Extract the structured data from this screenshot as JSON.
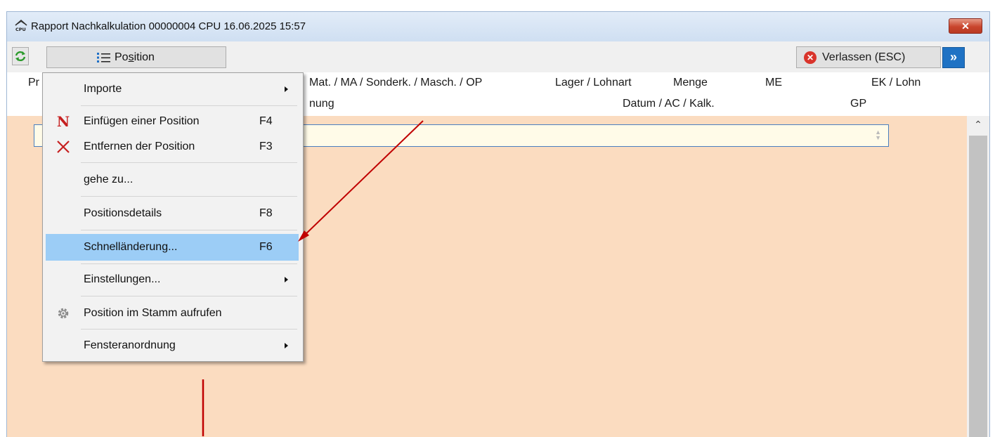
{
  "window": {
    "title": "Rapport Nachkalkulation 00000004 CPU 16.06.2025 15:57",
    "close_label": "✕"
  },
  "toolbar": {
    "position_label_pre": "Po",
    "position_label_u": "s",
    "position_label_post": "ition",
    "exit_label": "Verlassen (ESC)",
    "forward_label": "»"
  },
  "table_header": {
    "row1": [
      "Pr",
      "Mat. / MA / Sonderk. / Masch. / OP",
      "Lager / Lohnart",
      "Menge",
      "ME",
      "EK / Lohn"
    ],
    "row2": [
      "nung",
      "Datum / AC / Kalk.",
      "GP"
    ]
  },
  "menu": {
    "items": [
      {
        "label": "Importe",
        "shortcut": "",
        "submenu": true,
        "icon": ""
      },
      {
        "label": "Einfügen einer Position",
        "shortcut": "F4",
        "submenu": false,
        "icon": "new-n-icon"
      },
      {
        "label": "Entfernen der Position",
        "shortcut": "F3",
        "submenu": false,
        "icon": "delete-x-icon"
      },
      {
        "label": "gehe zu...",
        "shortcut": "",
        "submenu": false,
        "icon": ""
      },
      {
        "label": "Positionsdetails",
        "shortcut": "F8",
        "submenu": false,
        "icon": ""
      },
      {
        "label": "Schnelländerung...",
        "shortcut": "F6",
        "submenu": false,
        "icon": "",
        "highlighted": true
      },
      {
        "label": "Einstellungen...",
        "shortcut": "",
        "submenu": true,
        "icon": ""
      },
      {
        "label": "Position im Stamm aufrufen",
        "shortcut": "",
        "submenu": false,
        "icon": "gear-icon"
      },
      {
        "label": "Fensteranordnung",
        "shortcut": "",
        "submenu": true,
        "icon": ""
      }
    ]
  },
  "colors": {
    "content_bg": "#fbdcc0",
    "highlight": "#9ccdf6",
    "annotation_arrow": "#c00000"
  }
}
